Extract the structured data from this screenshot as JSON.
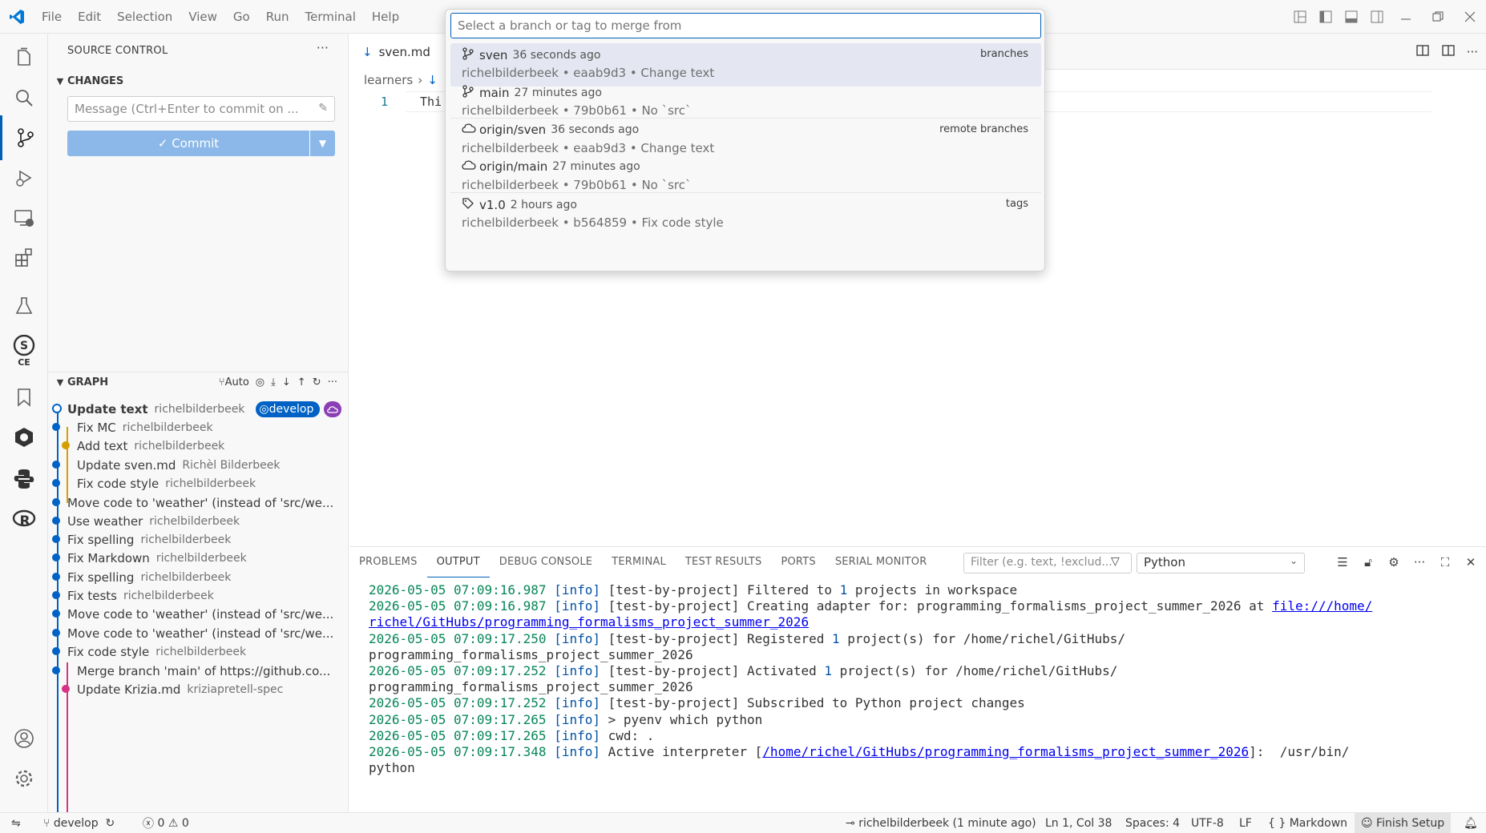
{
  "menu": [
    "File",
    "Edit",
    "Selection",
    "View",
    "Go",
    "Run",
    "Terminal",
    "Help"
  ],
  "sidebar": {
    "title": "SOURCE CONTROL",
    "changes_label": "CHANGES",
    "message_placeholder": "Message (Ctrl+Enter to commit on ...",
    "commit_label": "Commit",
    "graph_label": "GRAPH",
    "graph_auto_label": "Auto",
    "graph": [
      {
        "title": "Update text",
        "author": "richelbilderbeek",
        "bold": true
      },
      {
        "title": "Fix MC",
        "author": "richelbilderbeek"
      },
      {
        "title": "Add text",
        "author": "richelbilderbeek"
      },
      {
        "title": "Update sven.md",
        "author": "Richèl Bilderbeek"
      },
      {
        "title": "Fix code style",
        "author": "richelbilderbeek"
      },
      {
        "title": "Move code to 'weather' (instead of 'src/we...",
        "author": ""
      },
      {
        "title": "Use weather",
        "author": "richelbilderbeek"
      },
      {
        "title": "Fix spelling",
        "author": "richelbilderbeek"
      },
      {
        "title": "Fix Markdown",
        "author": "richelbilderbeek"
      },
      {
        "title": "Fix spelling",
        "author": "richelbilderbeek"
      },
      {
        "title": "Fix tests",
        "author": "richelbilderbeek"
      },
      {
        "title": "Move code to 'weather' (instead of 'src/we...",
        "author": ""
      },
      {
        "title": "Move code to 'weather' (instead of 'src/we...",
        "author": ""
      },
      {
        "title": "Fix code style",
        "author": "richelbilderbeek"
      },
      {
        "title": "Merge branch 'main' of https://github.co...",
        "author": ""
      },
      {
        "title": "Update Krizia.md",
        "author": "kriziapretell-spec"
      }
    ],
    "branch_badge": "develop"
  },
  "editor": {
    "tab": "sven.md",
    "breadcrumb": "learners",
    "line_number": "1",
    "code": "Thi"
  },
  "quickpick": {
    "placeholder": "Select a branch or tag to merge from",
    "items": [
      {
        "name": "sven",
        "ago": "36 seconds ago",
        "detail": "richelbilderbeek • eaab9d3 • Change text",
        "group": "branches",
        "icon": "branch"
      },
      {
        "name": "main",
        "ago": "27 minutes ago",
        "detail": "richelbilderbeek • 79b0b61 • No `src`",
        "group": "",
        "icon": "branch"
      },
      {
        "name": "origin/sven",
        "ago": "36 seconds ago",
        "detail": "richelbilderbeek • eaab9d3 • Change text",
        "group": "remote branches",
        "icon": "cloud"
      },
      {
        "name": "origin/main",
        "ago": "27 minutes ago",
        "detail": "richelbilderbeek • 79b0b61 • No `src`",
        "group": "",
        "icon": "cloud"
      },
      {
        "name": "v1.0",
        "ago": "2 hours ago",
        "detail": "richelbilderbeek • b564859 • Fix code style",
        "group": "tags",
        "icon": "tag"
      }
    ]
  },
  "panel": {
    "tabs": [
      "PROBLEMS",
      "OUTPUT",
      "DEBUG CONSOLE",
      "TERMINAL",
      "TEST RESULTS",
      "PORTS",
      "SERIAL MONITOR"
    ],
    "active_tab": "OUTPUT",
    "filter_placeholder": "Filter (e.g. text, !exclud...",
    "channel": "Python",
    "lines": [
      {
        "date": "2026-05-05 07:09:16.987",
        "level": "[info]",
        "text": " [test-by-project] Filtered to ",
        "num": "1",
        "rest": " projects in workspace"
      },
      {
        "date": "2026-05-05 07:09:16.987",
        "level": "[info]",
        "text": " [test-by-project] Creating adapter for: programming_formalisms_project_summer_2026 at ",
        "link": "file:///home/"
      },
      {
        "link": "richel/GitHubs/programming_formalisms_project_summer_2026"
      },
      {
        "date": "2026-05-05 07:09:17.250",
        "level": "[info]",
        "text": " [test-by-project] Registered ",
        "num": "1",
        "rest": " project(s) for /home/richel/GitHubs/"
      },
      {
        "plain": "programming_formalisms_project_summer_2026"
      },
      {
        "date": "2026-05-05 07:09:17.252",
        "level": "[info]",
        "text": " [test-by-project] Activated ",
        "num": "1",
        "rest": " project(s) for /home/richel/GitHubs/"
      },
      {
        "plain": "programming_formalisms_project_summer_2026"
      },
      {
        "date": "2026-05-05 07:09:17.252",
        "level": "[info]",
        "text": " [test-by-project] Subscribed to Python project changes"
      },
      {
        "date": "2026-05-05 07:09:17.265",
        "level": "[info]",
        "text": " > pyenv which python"
      },
      {
        "date": "2026-05-05 07:09:17.265",
        "level": "[info]",
        "text": " cwd: ."
      },
      {
        "date": "2026-05-05 07:09:17.348",
        "level": "[info]",
        "text": " Active interpreter [",
        "link": "/home/richel/GitHubs/programming_formalisms_project_summer_2026",
        "rest": "]:  /usr/bin/"
      },
      {
        "plain": "python"
      }
    ]
  },
  "status": {
    "branch": "develop",
    "errors": "0",
    "warnings": "0",
    "blame": "richelbilderbeek (1 minute ago)",
    "position": "Ln 1, Col 38",
    "spaces": "Spaces: 4",
    "encoding": "UTF-8",
    "eol": "LF",
    "language": "Markdown",
    "finish": "Finish Setup"
  }
}
